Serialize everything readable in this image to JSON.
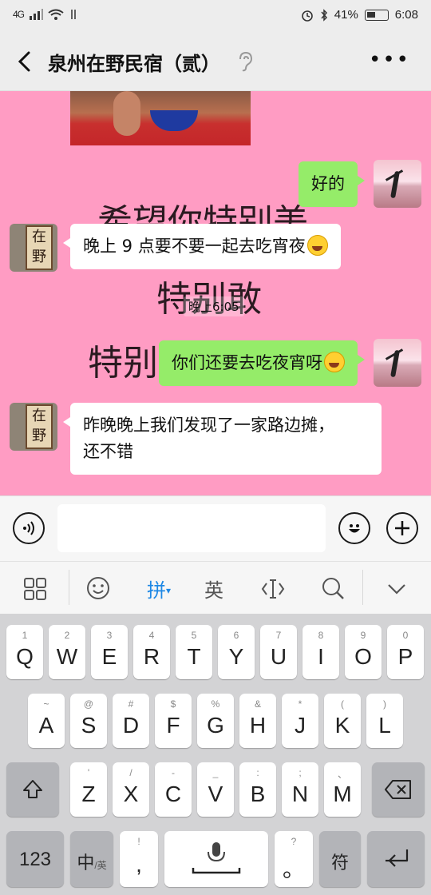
{
  "status": {
    "signal": "4G",
    "battery": "41%",
    "time": "6:08"
  },
  "header": {
    "title": "泉州在野民宿（贰）"
  },
  "chat": {
    "wall_lines": [
      "希望你特别美",
      "特别敢",
      "特别"
    ],
    "timestamp": "晚上6:05",
    "other_avatar_text": "在野",
    "messages": [
      {
        "from": "me",
        "text": "好的"
      },
      {
        "from": "other",
        "text": "晚上 9 点要不要一起去吃宵夜"
      },
      {
        "from": "me",
        "text": "你们还要去吃夜宵呀"
      },
      {
        "from": "other",
        "line1": "昨晚晚上我们发现了一家路边摊，",
        "line2": "还不错"
      }
    ]
  },
  "input": {
    "placeholder": ""
  },
  "ime": {
    "pinyin": "拼",
    "english": "英"
  },
  "keyboard": {
    "row1": [
      {
        "hint": "1",
        "key": "Q"
      },
      {
        "hint": "2",
        "key": "W"
      },
      {
        "hint": "3",
        "key": "E"
      },
      {
        "hint": "4",
        "key": "R"
      },
      {
        "hint": "5",
        "key": "T"
      },
      {
        "hint": "6",
        "key": "Y"
      },
      {
        "hint": "7",
        "key": "U"
      },
      {
        "hint": "8",
        "key": "I"
      },
      {
        "hint": "9",
        "key": "O"
      },
      {
        "hint": "0",
        "key": "P"
      }
    ],
    "row2": [
      {
        "hint": "~",
        "key": "A"
      },
      {
        "hint": "@",
        "key": "S"
      },
      {
        "hint": "#",
        "key": "D"
      },
      {
        "hint": "$",
        "key": "F"
      },
      {
        "hint": "%",
        "key": "G"
      },
      {
        "hint": "&",
        "key": "H"
      },
      {
        "hint": "*",
        "key": "J"
      },
      {
        "hint": "(",
        "key": "K"
      },
      {
        "hint": ")",
        "key": "L"
      }
    ],
    "row3": [
      {
        "hint": "'",
        "key": "Z"
      },
      {
        "hint": "/",
        "key": "X"
      },
      {
        "hint": "-",
        "key": "C"
      },
      {
        "hint": "_",
        "key": "V"
      },
      {
        "hint": ":",
        "key": "B"
      },
      {
        "hint": ";",
        "key": "N"
      },
      {
        "hint": "、",
        "key": "M"
      }
    ],
    "num_key": "123",
    "lang_key_main": "中",
    "lang_key_sub": "/英",
    "comma_hint": "!",
    "comma_key": ",",
    "period_hint": "?",
    "period_key": "。",
    "symbol_key": "符"
  },
  "colors": {
    "chat_bg": "#ff9cc3",
    "my_bubble": "#95ec69",
    "other_bubble": "#ffffff",
    "ime_accent": "#1e88e5"
  }
}
